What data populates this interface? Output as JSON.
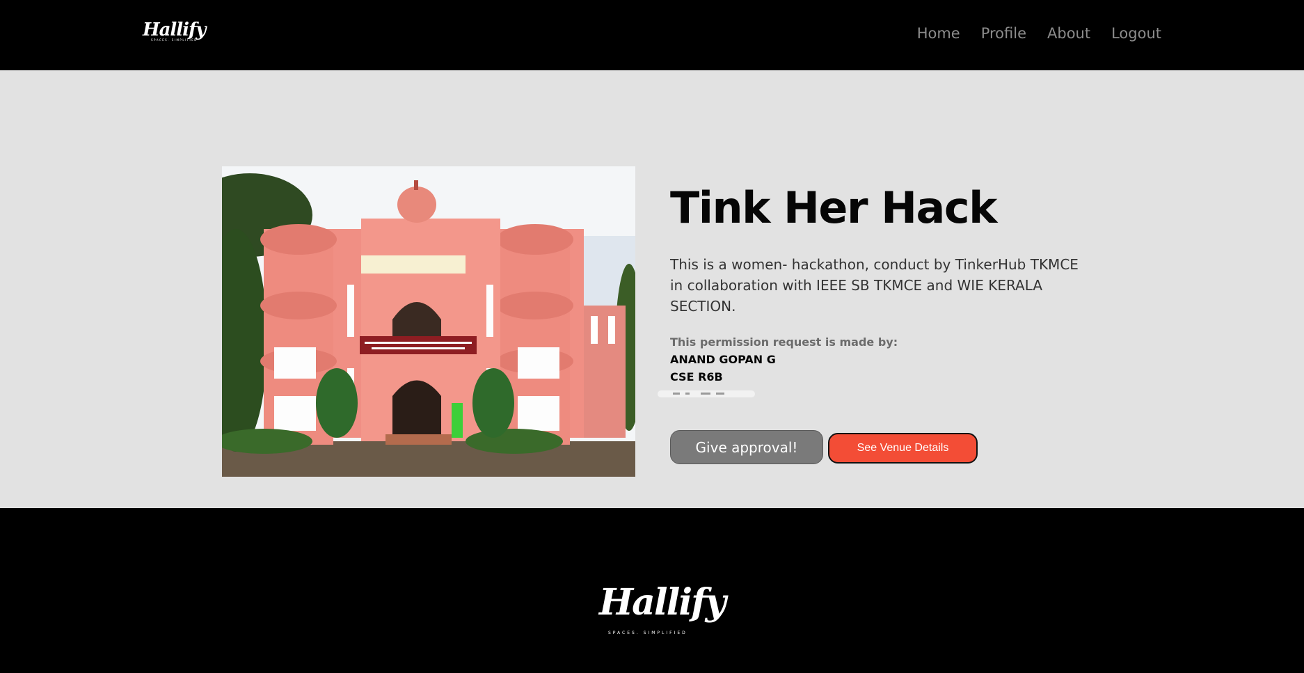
{
  "header": {
    "logo_text": "Hallify",
    "logo_tagline": "SPACES. SIMPLIFIED",
    "nav": [
      {
        "label": "Home"
      },
      {
        "label": "Profile"
      },
      {
        "label": "About"
      },
      {
        "label": "Logout"
      }
    ]
  },
  "event": {
    "title": "Tink Her Hack",
    "description": "This is a women- hackathon, conduct by TinkerHub TKMCE in collaboration with IEEE SB TKMCE and WIE KERALA SECTION.",
    "request_label": "This permission request is made by:",
    "requester_name": "ANAND GOPAN G",
    "requester_class": "CSE R6B",
    "image_alt": "THANGAL KUNJU MUSALIAR COLLEGE OF ENGINEERING"
  },
  "actions": {
    "approve_label": "Give approval!",
    "venue_label": "See Venue Details"
  },
  "footer": {
    "logo_text": "Hallify",
    "logo_tagline": "SPACES. SIMPLIFIED"
  },
  "colors": {
    "header_bg": "#000000",
    "body_bg": "#e2e2e2",
    "approve_bg": "#7a7a7a",
    "venue_bg": "#f34d36"
  }
}
